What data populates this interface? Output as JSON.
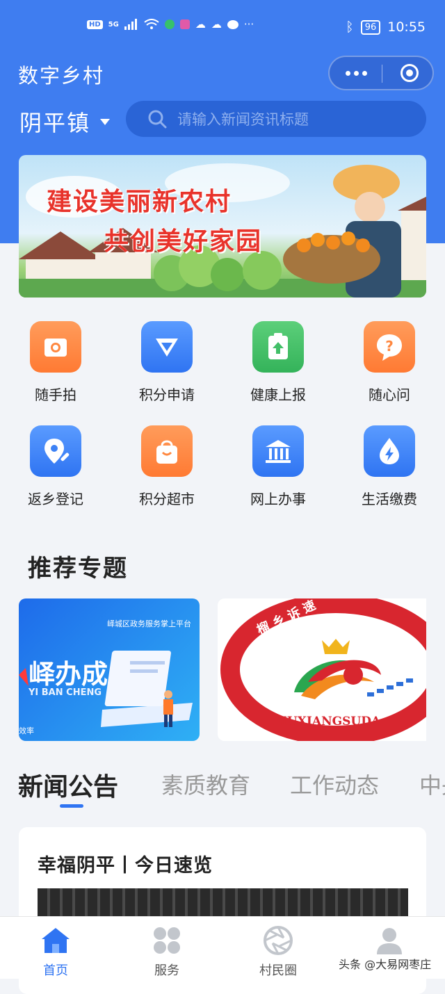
{
  "status_bar": {
    "left_icons": [
      "HD",
      "5G"
    ],
    "time": "10:55",
    "battery": "96"
  },
  "nav": {
    "title": "数字乡村"
  },
  "location": {
    "town": "阴平镇"
  },
  "search": {
    "placeholder": "请输入新闻资讯标题"
  },
  "banner": {
    "line1": "建设美丽新农村",
    "line2": "共创美好家园"
  },
  "grid_items": [
    {
      "label": "随手拍",
      "icon": "camera-icon",
      "color": "orange"
    },
    {
      "label": "积分申请",
      "icon": "diamond-icon",
      "color": "blue"
    },
    {
      "label": "健康上报",
      "icon": "clipboard-upload-icon",
      "color": "green"
    },
    {
      "label": "随心问",
      "icon": "question-bubble-icon",
      "color": "orange"
    },
    {
      "label": "返乡登记",
      "icon": "location-edit-icon",
      "color": "blue"
    },
    {
      "label": "积分超市",
      "icon": "shopping-bag-icon",
      "color": "orange"
    },
    {
      "label": "网上办事",
      "icon": "government-building-icon",
      "color": "blue"
    },
    {
      "label": "生活缴费",
      "icon": "water-drop-bolt-icon",
      "color": "blue"
    }
  ],
  "recommended": {
    "title": "推荐专题",
    "topic1": {
      "small": "峄城区政务服务掌上平台",
      "big": "峄办成",
      "en": "YI BAN CHENG",
      "foot": "效率"
    },
    "topic2": {
      "circle_top": "榴 乡 诉 速",
      "circle_bottom": "LIUXIANGSUDA"
    }
  },
  "tabs": [
    "新闻公告",
    "素质教育",
    "工作动态",
    "中央"
  ],
  "news": {
    "title": "幸福阴平丨今日速览"
  },
  "bottom_nav": [
    {
      "label": "首页",
      "icon": "home-icon",
      "active": true
    },
    {
      "label": "服务",
      "icon": "grid-services-icon",
      "active": false
    },
    {
      "label": "村民圈",
      "icon": "aperture-icon",
      "active": false
    },
    {
      "label": "",
      "icon": "person-icon",
      "active": false
    }
  ],
  "watermark": "头条 @大易网枣庄"
}
